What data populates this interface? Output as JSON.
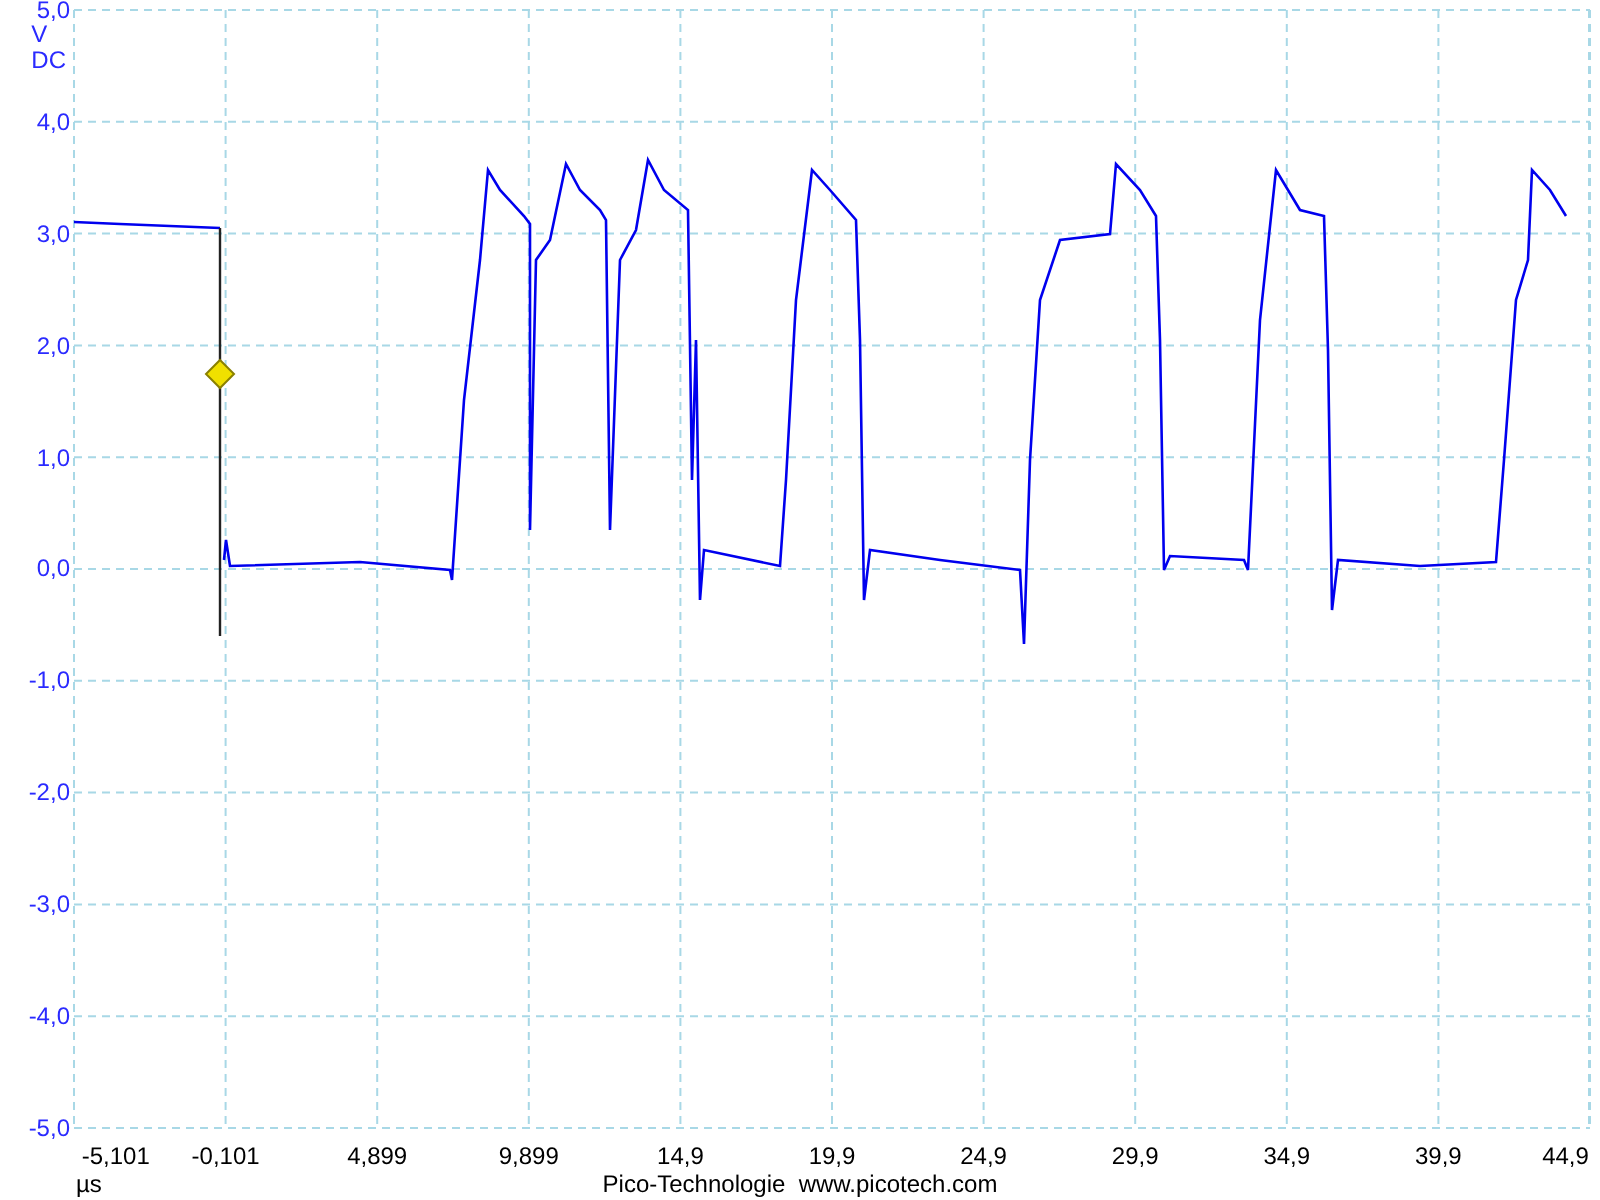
{
  "y_axis": {
    "unit": "V",
    "coupling": "DC",
    "ticks": [
      "5,0",
      "4,0",
      "3,0",
      "2,0",
      "1,0",
      "0,0",
      "-1,0",
      "-2,0",
      "-3,0",
      "-4,0",
      "-5,0"
    ]
  },
  "x_axis": {
    "unit": "µs",
    "ticks": [
      "-5,101",
      "-0,101",
      "4,899",
      "9,899",
      "14,9",
      "19,9",
      "24,9",
      "29,9",
      "34,9",
      "39,9",
      "44,9"
    ]
  },
  "footer": "Pico-Technologie  www.picotech.com"
}
